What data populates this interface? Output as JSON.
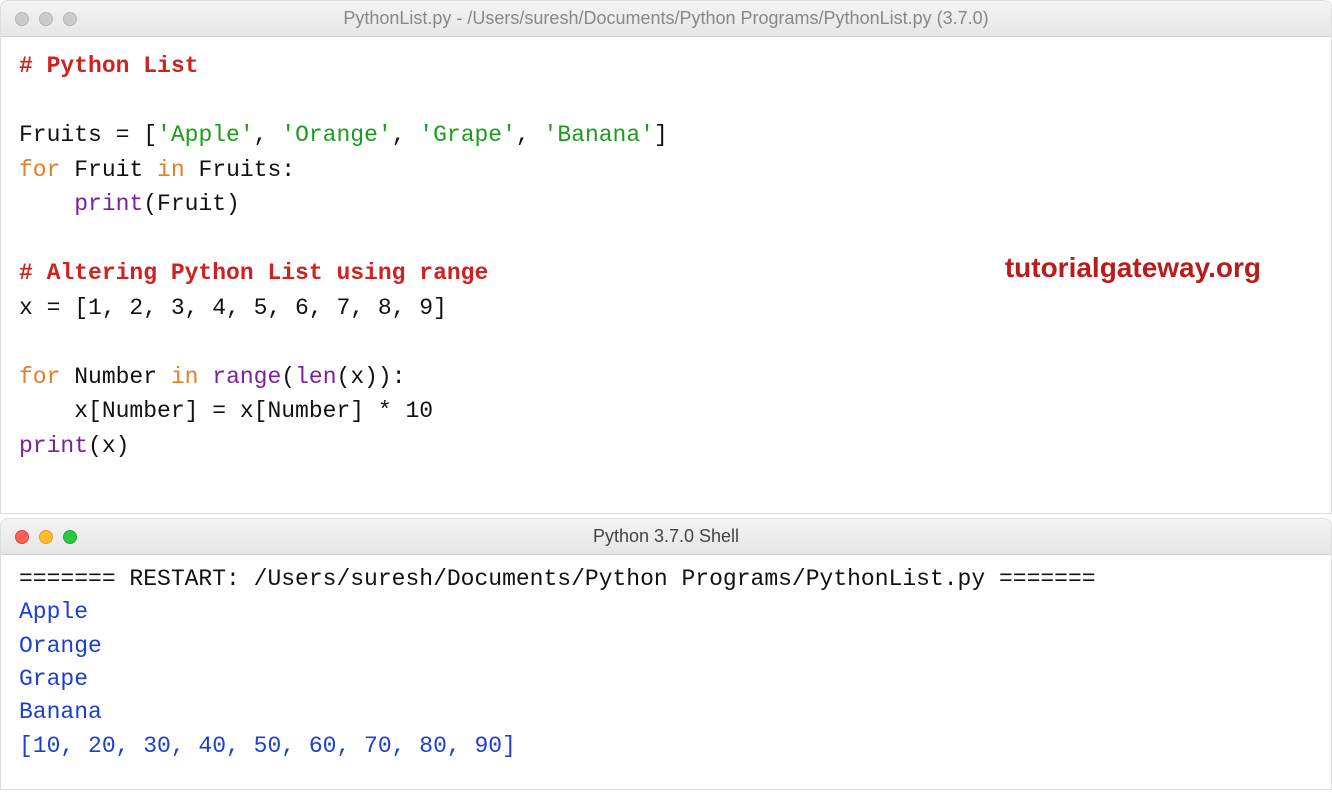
{
  "editor": {
    "title": "PythonList.py - /Users/suresh/Documents/Python Programs/PythonList.py (3.7.0)",
    "code": {
      "l1_comment": "# Python List",
      "l3_var": "Fruits = [",
      "l3_s1": "'Apple'",
      "l3_c1": ", ",
      "l3_s2": "'Orange'",
      "l3_c2": ", ",
      "l3_s3": "'Grape'",
      "l3_c3": ", ",
      "l3_s4": "'Banana'",
      "l3_end": "]",
      "l4_for": "for",
      "l4_mid": " Fruit ",
      "l4_in": "in",
      "l4_end": " Fruits:",
      "l5_indent": "    ",
      "l5_print": "print",
      "l5_args": "(Fruit)",
      "l7_comment": "# Altering Python List using range",
      "l8": "x = [1, 2, 3, 4, 5, 6, 7, 8, 9]",
      "l10_for": "for",
      "l10_mid": " Number ",
      "l10_in": "in",
      "l10_sp": " ",
      "l10_range": "range",
      "l10_p1": "(",
      "l10_len": "len",
      "l10_p2": "(x)):",
      "l11": "    x[Number] = x[Number] * 10",
      "l12_print": "print",
      "l12_args": "(x)"
    }
  },
  "watermark": "tutorialgateway.org",
  "shell": {
    "title": "Python 3.7.0 Shell",
    "restart": "======= RESTART: /Users/suresh/Documents/Python Programs/PythonList.py =======",
    "out1": "Apple",
    "out2": "Orange",
    "out3": "Grape",
    "out4": "Banana",
    "out5": "[10, 20, 30, 40, 50, 60, 70, 80, 90]"
  }
}
